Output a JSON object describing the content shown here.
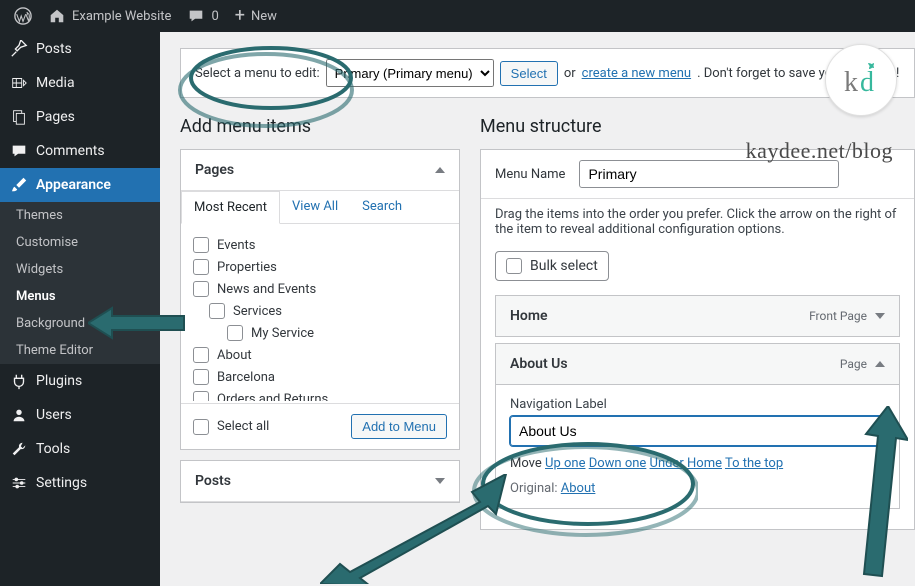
{
  "admin_bar": {
    "site_title": "Example Website",
    "comments": "0",
    "new": "New"
  },
  "sidebar": {
    "items": [
      {
        "label": "Posts"
      },
      {
        "label": "Media"
      },
      {
        "label": "Pages"
      },
      {
        "label": "Comments"
      },
      {
        "label": "Appearance"
      },
      {
        "label": "Plugins"
      },
      {
        "label": "Users"
      },
      {
        "label": "Tools"
      },
      {
        "label": "Settings"
      }
    ],
    "appearance_sub": [
      {
        "label": "Themes"
      },
      {
        "label": "Customise"
      },
      {
        "label": "Widgets"
      },
      {
        "label": "Menus"
      },
      {
        "label": "Background"
      },
      {
        "label": "Theme Editor"
      }
    ]
  },
  "edit_bar": {
    "label": "Select a menu to edit:",
    "dropdown_selected": "Primary (Primary menu)",
    "select_btn": "Select",
    "or": "or",
    "create_link": "create a new menu",
    "trailing": ". Don't forget to save your changes!"
  },
  "headings": {
    "left": "Add menu items",
    "right": "Menu structure"
  },
  "accordion": {
    "pages": {
      "title": "Pages",
      "tabs": [
        "Most Recent",
        "View All",
        "Search"
      ],
      "items": [
        "Events",
        "Properties",
        "News and Events",
        "Services",
        "My Service",
        "About",
        "Barcelona",
        "Orders and Returns"
      ],
      "select_all": "Select all",
      "add_btn": "Add to Menu"
    },
    "posts_title": "Posts"
  },
  "structure": {
    "menu_name_label": "Menu Name",
    "menu_name_value": "Primary",
    "hint": "Drag the items into the order you prefer. Click the arrow on the right of the item to reveal additional configuration options.",
    "bulk": "Bulk select",
    "items": [
      {
        "label": "Home",
        "type": "Front Page"
      },
      {
        "label": "About Us",
        "type": "Page"
      }
    ],
    "nav_label": "Navigation Label",
    "nav_value": "About Us",
    "move": "Move",
    "move_links": [
      "Up one",
      "Down one",
      "Under Home",
      "To the top"
    ],
    "original": "Original:",
    "original_link": "About"
  },
  "watermark": "kaydee.net/blog"
}
